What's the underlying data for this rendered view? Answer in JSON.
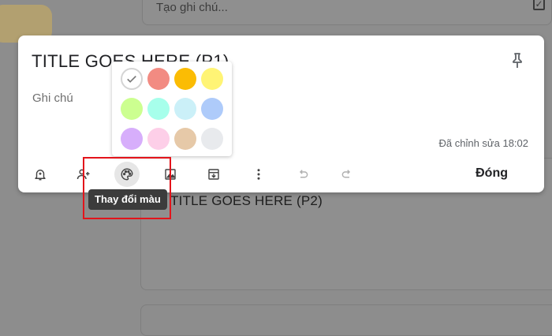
{
  "background": {
    "take_note_placeholder": "Tạo ghi chú...",
    "second_note_title": "TITLE GOES HERE (P2)"
  },
  "note": {
    "title": "TITLE GOES HERE (P1)",
    "body_placeholder": "Ghi chú",
    "edited_time": "Đã chỉnh sửa 18:02",
    "close_label": "Đóng"
  },
  "toolbar": {
    "items": [
      {
        "icon": "remind-bell-icon"
      },
      {
        "icon": "collaborator-icon"
      },
      {
        "icon": "palette-icon",
        "active": true
      },
      {
        "icon": "add-image-icon"
      },
      {
        "icon": "archive-icon"
      },
      {
        "icon": "more-vert-icon"
      },
      {
        "icon": "undo-icon"
      },
      {
        "icon": "redo-icon"
      }
    ]
  },
  "palette": {
    "colors": [
      {
        "name": "default",
        "hex": "#ffffff",
        "selected": true
      },
      {
        "name": "red",
        "hex": "#f28b82"
      },
      {
        "name": "orange",
        "hex": "#fbbc04"
      },
      {
        "name": "yellow",
        "hex": "#fff475"
      },
      {
        "name": "green",
        "hex": "#ccff90"
      },
      {
        "name": "teal",
        "hex": "#a7ffeb"
      },
      {
        "name": "blue",
        "hex": "#cbf0f8"
      },
      {
        "name": "dark-blue",
        "hex": "#aecbfa"
      },
      {
        "name": "purple",
        "hex": "#d7aefb"
      },
      {
        "name": "pink",
        "hex": "#fdcfe8"
      },
      {
        "name": "brown",
        "hex": "#e6c9a8"
      },
      {
        "name": "gray",
        "hex": "#e8eaed"
      }
    ]
  },
  "tooltip": {
    "label": "Thay đổi màu"
  },
  "colors": {
    "highlight": "#e3141b",
    "overlay": "#8d8d8d"
  }
}
